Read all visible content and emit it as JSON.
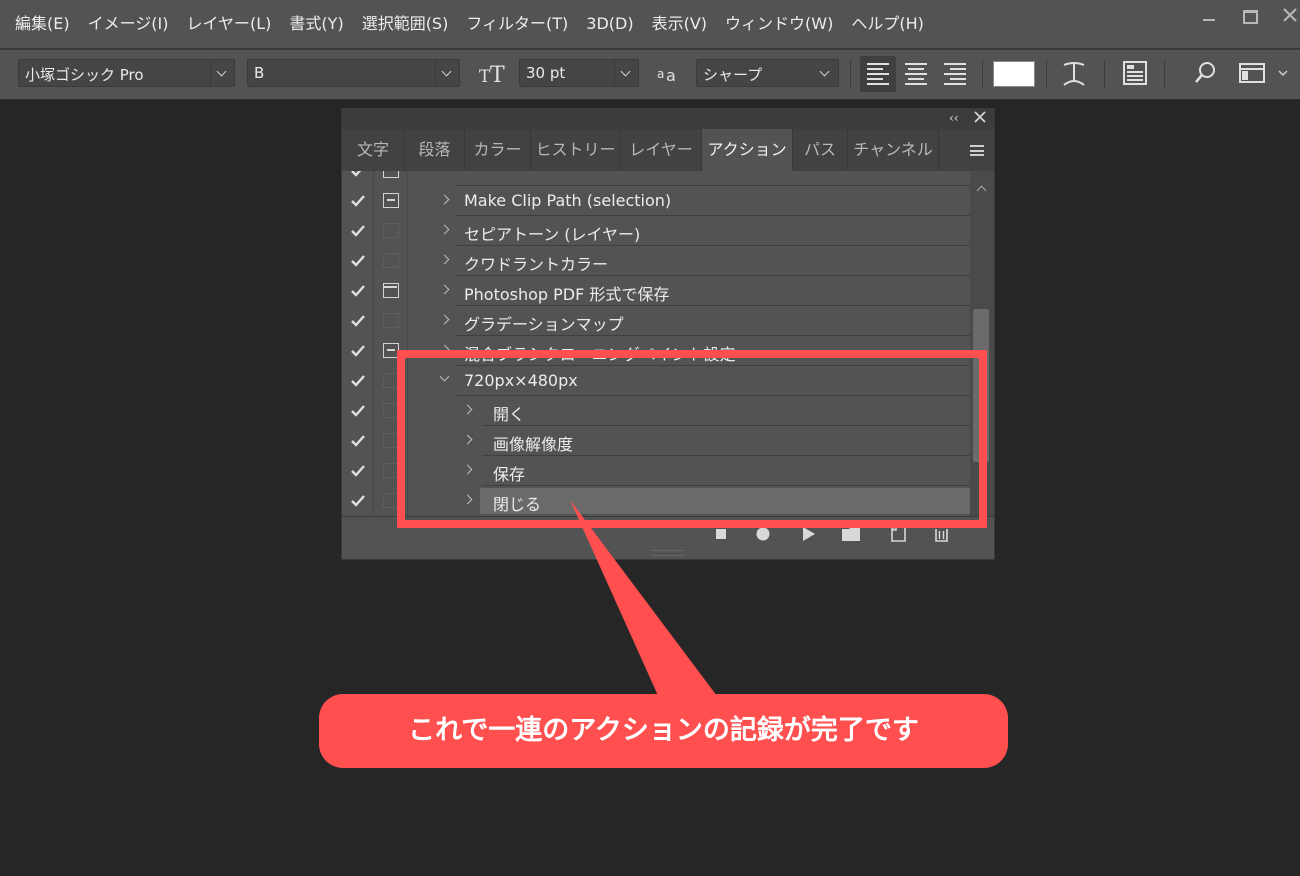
{
  "menu": [
    "編集(E)",
    "イメージ(I)",
    "レイヤー(L)",
    "書式(Y)",
    "選択範囲(S)",
    "フィルター(T)",
    "3D(D)",
    "表示(V)",
    "ウィンドウ(W)",
    "ヘルプ(H)"
  ],
  "options": {
    "font_family": "小塚ゴシック Pro",
    "font_style": "B",
    "font_size": "30 pt",
    "antialias": "シャープ",
    "text_color": "#ffffff"
  },
  "panel": {
    "tabs": [
      "文字",
      "段落",
      "カラー",
      "ヒストリー",
      "レイヤー",
      "アクション",
      "パス",
      "チャンネル"
    ],
    "active_tab": "アクション",
    "actions": [
      {
        "label": "Make Clip Path (selection)",
        "enabled": true,
        "dialog": "on"
      },
      {
        "label": "セピアトーン (レイヤー)",
        "enabled": true,
        "dialog": "off"
      },
      {
        "label": "クワドラントカラー",
        "enabled": true,
        "dialog": "off"
      },
      {
        "label": "Photoshop PDF 形式で保存",
        "enabled": true,
        "dialog": "frame"
      },
      {
        "label": "グラデーションマップ",
        "enabled": true,
        "dialog": "off"
      },
      {
        "label": "混合ブラシクローニングペイント設定",
        "enabled": true,
        "dialog": "on"
      },
      {
        "label": "720px×480px",
        "enabled": true,
        "dialog": "off",
        "expanded": true
      },
      {
        "label": "開く",
        "enabled": true,
        "dialog": "off",
        "step": true
      },
      {
        "label": "画像解像度",
        "enabled": true,
        "dialog": "off",
        "step": true
      },
      {
        "label": "保存",
        "enabled": true,
        "dialog": "off",
        "step": true
      },
      {
        "label": "閉じる",
        "enabled": true,
        "dialog": "off",
        "step": true,
        "selected": true
      }
    ],
    "bottom_buttons": [
      "stop-icon",
      "record-icon",
      "play-icon",
      "new-set-icon",
      "new-action-icon",
      "trash-icon"
    ]
  },
  "callout": {
    "text": "これで一連のアクションの記録が完了です",
    "color": "#ff4f4f"
  }
}
